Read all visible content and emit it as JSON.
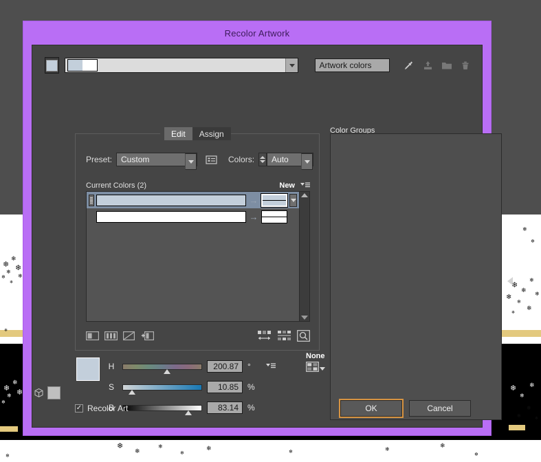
{
  "dialog": {
    "title": "Recolor Artwork",
    "title_bar_color": "#b96ef5",
    "body_color": "#454545"
  },
  "toolbar": {
    "active_swatch_color": "#c3cfdb",
    "combo_color_1": "#c3cfdb",
    "combo_color_2": "#ffffff",
    "group_name": "Artwork colors",
    "icons": [
      {
        "name": "eyedropper-icon",
        "label": "Color picker"
      },
      {
        "name": "save-color-group-icon",
        "label": "Save"
      },
      {
        "name": "new-color-group-icon",
        "label": "New Color Group"
      },
      {
        "name": "delete-color-group-icon",
        "label": "Delete Color Group"
      }
    ]
  },
  "tabs": [
    {
      "label": "Edit",
      "active": true
    },
    {
      "label": "Assign",
      "active": false
    }
  ],
  "preset": {
    "label": "Preset:",
    "value": "Custom",
    "options_icon": "preset-options-icon"
  },
  "colors_control": {
    "label": "Colors:",
    "value": "Auto"
  },
  "current_colors": {
    "header": "Current Colors (2)",
    "new_label": "New",
    "menu_icon": "panel-menu-icon",
    "rows": [
      {
        "selected": true,
        "current_color": "#c3cfdb",
        "new_color_top": "#c3cfdb",
        "new_color_bottom": "#c3cfdb",
        "arrow": "→"
      },
      {
        "selected": false,
        "current_color": "#ffffff",
        "new_color_top": "#ffffff",
        "new_color_bottom": "#ffffff",
        "arrow": "→"
      }
    ]
  },
  "list_tools": {
    "left": [
      {
        "name": "merge-colors-icon",
        "label": "Merge colors"
      },
      {
        "name": "separate-colors-icon",
        "label": "Separate colors"
      },
      {
        "name": "exclude-color-icon",
        "label": "Exclude color"
      },
      {
        "name": "add-color-icon",
        "label": "Add color"
      }
    ],
    "right": [
      {
        "name": "randomize-order-icon",
        "label": "Randomly change color order"
      },
      {
        "name": "randomize-brightness-icon",
        "label": "Randomly change saturation and brightness"
      },
      {
        "name": "color-reduction-options-icon",
        "label": "Color Reduction Options"
      }
    ]
  },
  "color_groups": {
    "label": "Color Groups",
    "items": [],
    "collapse_icon": "collapse-panel-icon"
  },
  "hsb": {
    "preview_color": "#c3cfdb",
    "cube_icon": "color-mode-cube-icon",
    "secondary_swatch": "#bfbfbf",
    "sliders": [
      {
        "channel": "H",
        "value": "200.87",
        "unit": "°",
        "position_pct": 56
      },
      {
        "channel": "S",
        "value": "10.85",
        "unit": "%",
        "position_pct": 11
      },
      {
        "channel": "B",
        "value": "83.14",
        "unit": "%",
        "position_pct": 83
      }
    ],
    "slider_menu_icon": "slider-options-icon"
  },
  "harmony": {
    "label": "None",
    "icon": "harmony-rules-icon"
  },
  "footer": {
    "recolor_art_label": "Recolor Art",
    "recolor_art_checked": true,
    "check_glyph": "✓",
    "ok_label": "OK",
    "cancel_label": "Cancel",
    "focus_color": "#d79442"
  }
}
